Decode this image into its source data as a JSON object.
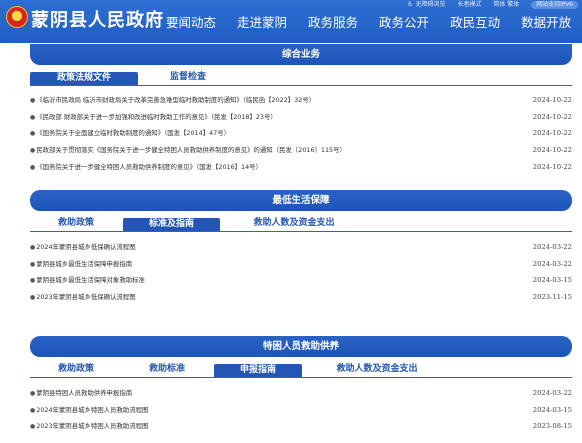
{
  "header": {
    "site_title": "蒙阴县人民政府",
    "util": {
      "accessible": "无障碍浏览",
      "elderly": "长者模式",
      "lang": "简体 繁体",
      "search": "网站支持IPv6"
    },
    "nav": [
      "要闻动态",
      "走进蒙阴",
      "政务服务",
      "政务公开",
      "政民互动",
      "数据开放"
    ]
  },
  "section1": {
    "title": "综合业务",
    "tabs": [
      "政策法规文件",
      "监督检查"
    ],
    "active_tab": 0,
    "rows": [
      {
        "title": "《临沂市民政局 临沂市财政局关于改革完善急难型临时救助制度的通知》（临民函【2022】32号）",
        "date": "2024-10-22"
      },
      {
        "title": "《民政部 财政部关于进一步加强和改进临时救助工作的意见》（民发【2018】23号）",
        "date": "2024-10-22"
      },
      {
        "title": "《国务院关于全面建立临时救助制度的通知》（国发【2014】47号）",
        "date": "2024-10-22"
      },
      {
        "title": "民政部关于贯彻落实《国务院关于进一步健全特困人员救助供养制度的意见》的通知（民发〔2016〕115号）",
        "date": "2024-10-22"
      },
      {
        "title": "《国务院关于进一步健全特困人员救助供养制度的意见》（国发【2016】14号）",
        "date": "2024-10-22"
      }
    ]
  },
  "section2": {
    "title": "最低生活保障",
    "tabs": [
      "救助政策",
      "标准及指南",
      "救助人数及资金支出"
    ],
    "active_tab": 1,
    "rows": [
      {
        "title": "2024年蒙阴县城乡低保确认流程图",
        "date": "2024-03-22"
      },
      {
        "title": "蒙阴县城乡最低生活保障申报指南",
        "date": "2024-03-22"
      },
      {
        "title": "蒙阴县城乡最低生活保障对象救助标准",
        "date": "2024-03-15"
      },
      {
        "title": "2023年蒙阴县城乡低保确认流程图",
        "date": "2023-11-15"
      }
    ]
  },
  "section3": {
    "title": "特困人员救助供养",
    "tabs": [
      "救助政策",
      "救助标准",
      "申报指南",
      "救助人数及资金支出"
    ],
    "active_tab": 2,
    "rows": [
      {
        "title": "蒙阴县特困人员救助供养申报指南",
        "date": "2024-03-22"
      },
      {
        "title": "2024年蒙阴县城乡特困人员救助流程图",
        "date": "2024-03-15"
      },
      {
        "title": "2023年蒙阴县城乡特困人员救助流程图",
        "date": "2023-08-15"
      }
    ]
  },
  "colors": {
    "brand_blue": "#2456b5",
    "header_blue": "#2f6fd1",
    "emblem_red": "#d8261c",
    "emblem_gold": "#ffd84a"
  },
  "icons": {
    "emblem": "national-emblem-icon",
    "accessible": "accessibility-icon",
    "bullet": "bullet-dot-icon"
  }
}
